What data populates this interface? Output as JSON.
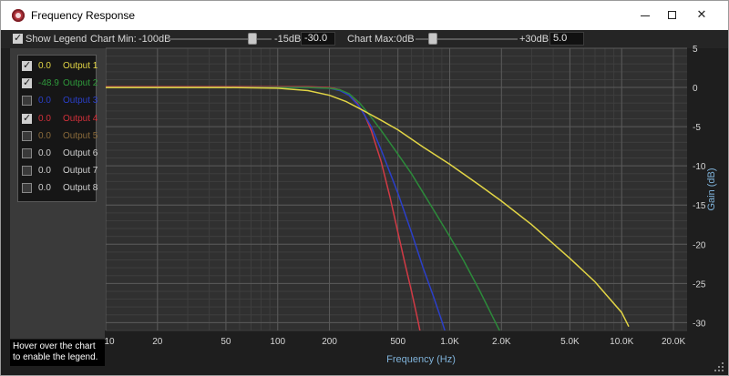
{
  "window": {
    "title": "Frequency Response",
    "controls": {
      "minimize": "minimize-icon",
      "maximize": "maximize-icon",
      "close": "✕"
    }
  },
  "toolbar": {
    "show_legend": {
      "label": "Show Legend",
      "checked": true
    },
    "chart_min": {
      "label": "Chart Min:",
      "range_min": "-100dB",
      "range_max": "-15dB",
      "value": "-30.0",
      "slider_level": 0.82
    },
    "chart_max": {
      "label": "Chart Max:",
      "range_min": "0dB",
      "range_max": "+30dB",
      "value": "5.0",
      "slider_level": 0.17
    }
  },
  "legend": {
    "items": [
      {
        "value": "0.0",
        "name": "Output 1",
        "checked": true,
        "enabled": true,
        "color": "#e2d545"
      },
      {
        "value": "-48.9",
        "name": "Output 2",
        "checked": true,
        "enabled": true,
        "color": "#2f9a3c"
      },
      {
        "value": "0.0",
        "name": "Output 3",
        "checked": false,
        "enabled": true,
        "color": "#2a3fc9"
      },
      {
        "value": "0.0",
        "name": "Output 4",
        "checked": true,
        "enabled": true,
        "color": "#d2303a"
      },
      {
        "value": "0.0",
        "name": "Output 5",
        "checked": false,
        "enabled": false,
        "color": "#8a6a3a"
      },
      {
        "value": "0.0",
        "name": "Output 6",
        "checked": false,
        "enabled": false,
        "color": "#cfcfcf"
      },
      {
        "value": "0.0",
        "name": "Output 7",
        "checked": false,
        "enabled": false,
        "color": "#cfcfcf"
      },
      {
        "value": "0.0",
        "name": "Output 8",
        "checked": false,
        "enabled": false,
        "color": "#cfcfcf"
      }
    ]
  },
  "hint": "Hover over the chart to enable the legend.",
  "chart_data": {
    "type": "line",
    "xlabel": "Frequency (Hz)",
    "ylabel": "Gain (dB)",
    "x_scale": "log",
    "xlim": [
      10,
      24000
    ],
    "ylim": [
      -31,
      5
    ],
    "grid": true,
    "x_ticks": [
      {
        "value": 10,
        "label": "10"
      },
      {
        "value": 20,
        "label": "20"
      },
      {
        "value": 50,
        "label": "50"
      },
      {
        "value": 100,
        "label": "100"
      },
      {
        "value": 200,
        "label": "200"
      },
      {
        "value": 500,
        "label": "500"
      },
      {
        "value": 1000,
        "label": "1.0K"
      },
      {
        "value": 2000,
        "label": "2.0K"
      },
      {
        "value": 5000,
        "label": "5.0K"
      },
      {
        "value": 10000,
        "label": "10.0K"
      },
      {
        "value": 20000,
        "label": "20.0K"
      }
    ],
    "y_ticks": [
      {
        "value": 5,
        "label": "5"
      },
      {
        "value": 0,
        "label": "0"
      },
      {
        "value": -5,
        "label": "-5"
      },
      {
        "value": -10,
        "label": "-10"
      },
      {
        "value": -15,
        "label": "-15"
      },
      {
        "value": -20,
        "label": "-20"
      },
      {
        "value": -25,
        "label": "-25"
      },
      {
        "value": -30,
        "label": "-30"
      }
    ],
    "series": [
      {
        "color": "#d13a45",
        "x": [
          10,
          30,
          100,
          150,
          200,
          230,
          260,
          290,
          320,
          350,
          400,
          450,
          500,
          550,
          600,
          650,
          700
        ],
        "y": [
          0.1,
          0.1,
          0.1,
          0.1,
          0.0,
          -0.3,
          -1.0,
          -2.0,
          -3.5,
          -5.5,
          -9.5,
          -14.0,
          -18.5,
          -22.5,
          -26.0,
          -29.5,
          -33.0
        ]
      },
      {
        "color": "#2b3fc9",
        "x": [
          10,
          30,
          100,
          150,
          200,
          230,
          260,
          300,
          350,
          400,
          500,
          600,
          700,
          800,
          900,
          1000
        ],
        "y": [
          0.0,
          0.0,
          0.0,
          0.0,
          -0.1,
          -0.4,
          -1.0,
          -2.5,
          -5.0,
          -8.0,
          -13.5,
          -18.5,
          -23.0,
          -26.5,
          -29.8,
          -33.0
        ]
      },
      {
        "color": "#2c8a3a",
        "x": [
          10,
          30,
          100,
          150,
          200,
          230,
          260,
          300,
          350,
          400,
          500,
          600,
          800,
          1000,
          1200,
          1500,
          1800,
          2000
        ],
        "y": [
          0.0,
          0.0,
          0.0,
          0.0,
          -0.1,
          -0.3,
          -0.8,
          -2.0,
          -3.8,
          -5.5,
          -8.5,
          -11.0,
          -15.5,
          -19.0,
          -22.0,
          -26.0,
          -29.5,
          -31.5
        ]
      },
      {
        "color": "#e2d545",
        "x": [
          10,
          30,
          50,
          100,
          150,
          200,
          250,
          300,
          400,
          500,
          700,
          1000,
          1500,
          2000,
          3000,
          5000,
          7000,
          10000,
          11000
        ],
        "y": [
          0.0,
          0.0,
          0.0,
          -0.1,
          -0.4,
          -1.0,
          -1.8,
          -2.7,
          -4.2,
          -5.4,
          -7.6,
          -9.8,
          -12.5,
          -14.5,
          -17.5,
          -21.8,
          -24.8,
          -28.7,
          -30.5
        ]
      }
    ]
  }
}
